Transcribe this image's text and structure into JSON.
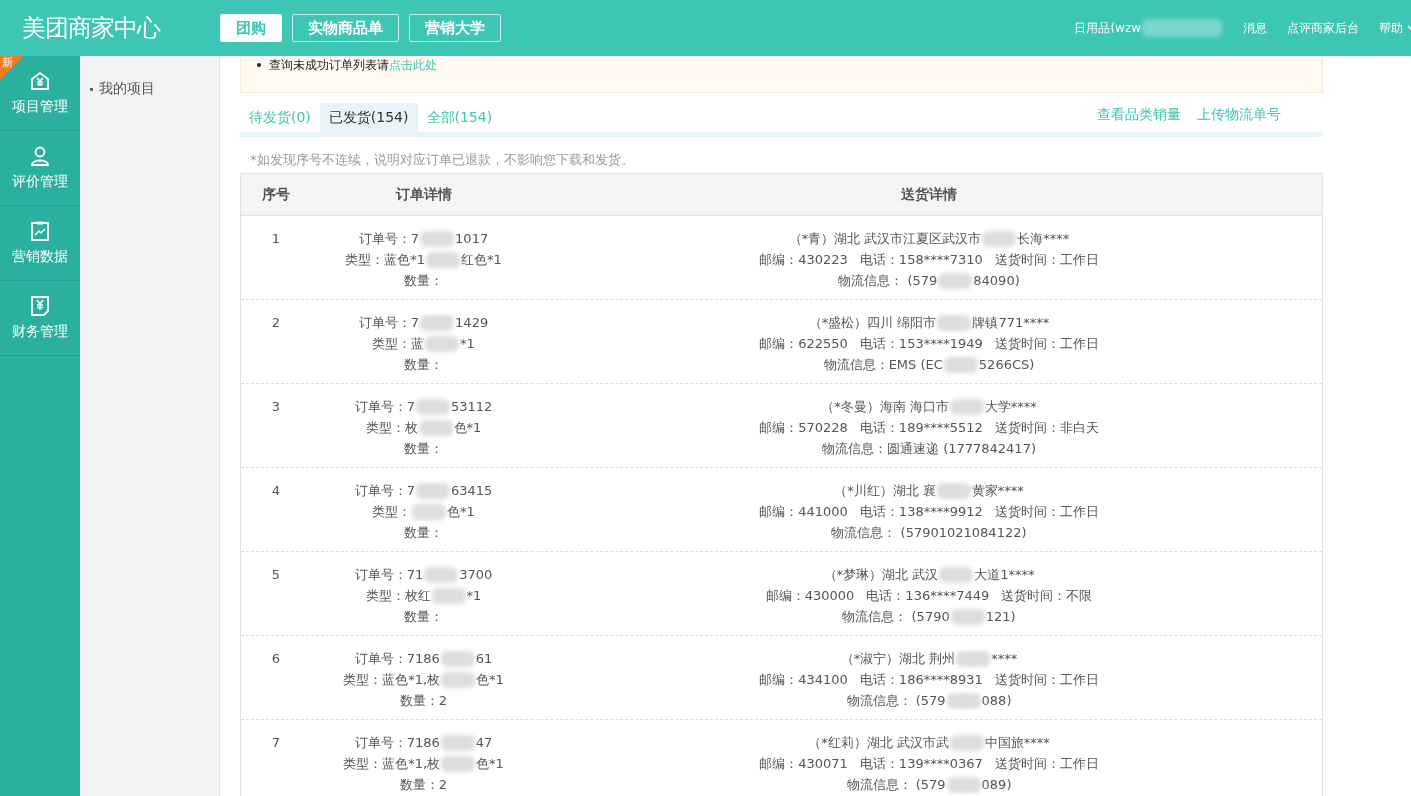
{
  "header": {
    "logo": "美团商家中心",
    "tabs": [
      {
        "label": "团购",
        "selected": true
      },
      {
        "label": "实物商品单",
        "selected": false
      },
      {
        "label": "营销大学",
        "selected": false
      }
    ],
    "user": [
      "日用品(wzw"
    ],
    "links": [
      "消息",
      "点评商家后台"
    ],
    "help": "帮助"
  },
  "nav": [
    {
      "label": "项目管理",
      "badge": "新"
    },
    {
      "label": "评价管理"
    },
    {
      "label": "营销数据"
    },
    {
      "label": "财务管理"
    }
  ],
  "subnav": [
    {
      "label": "我的项目"
    }
  ],
  "notice": {
    "text": "查询未成功订单列表请",
    "link": "点击此处"
  },
  "tabs": [
    {
      "label": "待发货(0)",
      "selected": false
    },
    {
      "label": "已发货(154)",
      "selected": true
    },
    {
      "label": "全部(154)",
      "selected": false
    }
  ],
  "actions": [
    "查看品类销量",
    "上传物流单号"
  ],
  "hint": "*如发现序号不连续，说明对应订单已退款，不影响您下载和发货。",
  "table": {
    "columns": [
      "序号",
      "订单详情",
      "送货详情"
    ],
    "rows": [
      {
        "no": "1",
        "order": [
          [
            "订单号：7",
            "1017"
          ],
          [
            "类型：蓝色*1",
            "红色*1"
          ],
          [
            "数量："
          ]
        ],
        "address": [
          "（*青）湖北 武汉市江夏区武汉市",
          "长海****"
        ],
        "zip": "邮编：430223",
        "phone": "电话：158****7310",
        "time": "送货时间：工作日",
        "logistics": [
          "物流信息： (579",
          "84090)"
        ]
      },
      {
        "no": "2",
        "order": [
          [
            "订单号：7",
            "1429"
          ],
          [
            "类型：蓝",
            "*1"
          ],
          [
            "数量："
          ]
        ],
        "address": [
          "（*盛松）四川 绵阳市",
          "牌镇771****"
        ],
        "zip": "邮编：622550",
        "phone": "电话：153****1949",
        "time": "送货时间：工作日",
        "logistics": [
          "物流信息：EMS (EC",
          "5266CS)"
        ]
      },
      {
        "no": "3",
        "order": [
          [
            "订单号：7",
            "53112"
          ],
          [
            "类型：枚",
            "色*1"
          ],
          [
            "数量："
          ]
        ],
        "address": [
          "（*冬曼）海南 海口市",
          "大学****"
        ],
        "zip": "邮编：570228",
        "phone": "电话：189****5512",
        "time": "送货时间：非白天",
        "logistics": [
          "物流信息：圆通速递 (1777842417)"
        ]
      },
      {
        "no": "4",
        "order": [
          [
            "订单号：7",
            "63415"
          ],
          [
            "类型：",
            "色*1"
          ],
          [
            "数量："
          ]
        ],
        "address": [
          "（*川红）湖北 襄",
          "黄家****"
        ],
        "zip": "邮编：441000",
        "phone": "电话：138****9912",
        "time": "送货时间：工作日",
        "logistics": [
          "物流信息： (57901021084122)"
        ]
      },
      {
        "no": "5",
        "order": [
          [
            "订单号：71",
            "3700"
          ],
          [
            "类型：枚红",
            "*1"
          ],
          [
            "数量："
          ]
        ],
        "address": [
          "（*梦琳）湖北 武汉",
          "大道1****"
        ],
        "zip": "邮编：430000",
        "phone": "电话：136****7449",
        "time": "送货时间：不限",
        "logistics": [
          "物流信息： (5790",
          "121)"
        ]
      },
      {
        "no": "6",
        "order": [
          [
            "订单号：7186",
            "61"
          ],
          [
            "类型：蓝色*1,枚",
            "色*1"
          ],
          [
            "数量：2"
          ]
        ],
        "address": [
          "（*淑宁）湖北 荆州",
          "****"
        ],
        "zip": "邮编：434100",
        "phone": "电话：186****8931",
        "time": "送货时间：工作日",
        "logistics": [
          "物流信息： (579",
          "088)"
        ]
      },
      {
        "no": "7",
        "order": [
          [
            "订单号：7186",
            "47"
          ],
          [
            "类型：蓝色*1,枚",
            "色*1"
          ],
          [
            "数量：2"
          ]
        ],
        "address": [
          "（*红莉）湖北 武汉市武",
          "中国旅****"
        ],
        "zip": "邮编：430071",
        "phone": "电话：139****0367",
        "time": "送货时间：工作日",
        "logistics": [
          "物流信息： (579",
          "089)"
        ]
      }
    ]
  }
}
